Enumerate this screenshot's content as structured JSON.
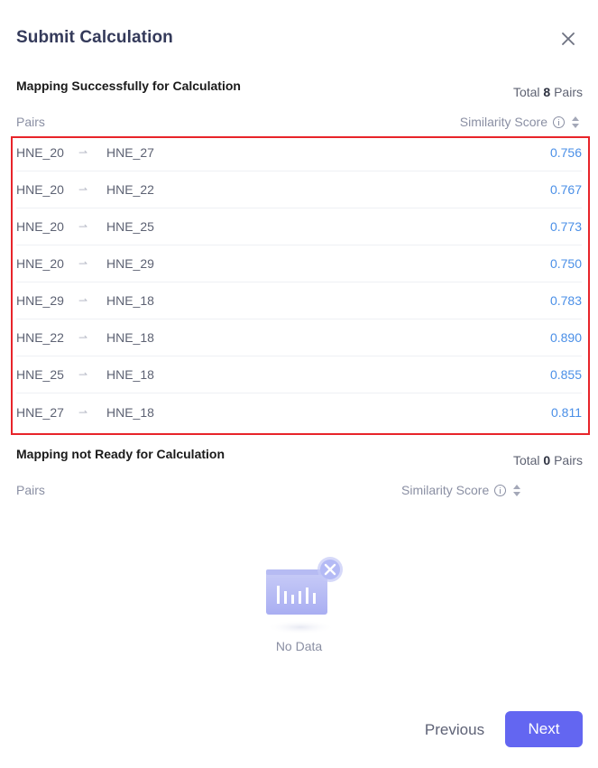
{
  "dialog": {
    "title": "Submit Calculation",
    "close_icon": "close-icon"
  },
  "success": {
    "title": "Mapping Successfully for Calculation",
    "total_prefix": "Total ",
    "total_count": "8",
    "total_suffix": " Pairs",
    "col_pairs": "Pairs",
    "col_score": "Similarity Score",
    "rows": [
      {
        "from": "HNE_20",
        "to": "HNE_27",
        "score": "0.756"
      },
      {
        "from": "HNE_20",
        "to": "HNE_22",
        "score": "0.767"
      },
      {
        "from": "HNE_20",
        "to": "HNE_25",
        "score": "0.773"
      },
      {
        "from": "HNE_20",
        "to": "HNE_29",
        "score": "0.750"
      },
      {
        "from": "HNE_29",
        "to": "HNE_18",
        "score": "0.783"
      },
      {
        "from": "HNE_22",
        "to": "HNE_18",
        "score": "0.890"
      },
      {
        "from": "HNE_25",
        "to": "HNE_18",
        "score": "0.855"
      },
      {
        "from": "HNE_27",
        "to": "HNE_18",
        "score": "0.811"
      }
    ]
  },
  "not_ready": {
    "title": "Mapping not Ready for Calculation",
    "total_prefix": "Total ",
    "total_count": "0",
    "total_suffix": " Pairs",
    "col_pairs": "Pairs",
    "col_score": "Similarity Score",
    "empty_text": "No Data"
  },
  "footer": {
    "previous_label": "Previous",
    "next_label": "Next"
  },
  "colors": {
    "accent": "#6366f1",
    "score": "#4a8fe7",
    "highlight_border": "#e8242a"
  }
}
